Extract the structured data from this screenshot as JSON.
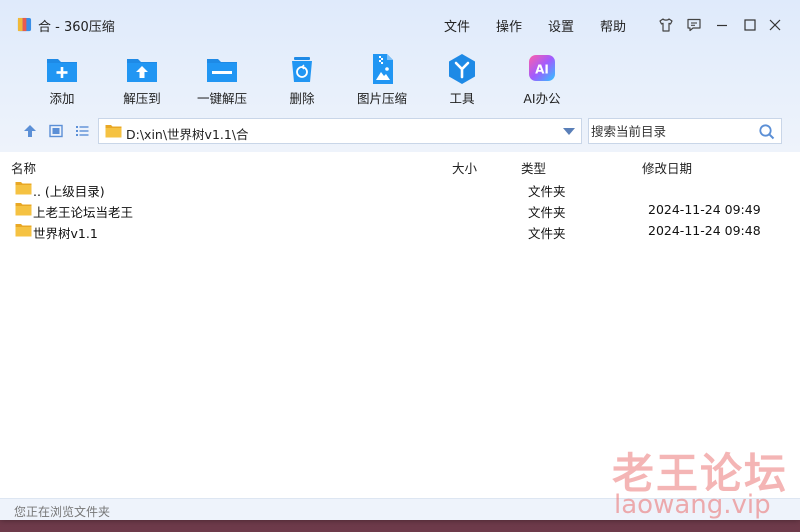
{
  "window": {
    "title": "合 - 360压缩"
  },
  "menu": [
    "文件",
    "操作",
    "设置",
    "帮助"
  ],
  "toolbar": [
    {
      "label": "添加",
      "icon": "add-icon"
    },
    {
      "label": "解压到",
      "icon": "extract-to-icon"
    },
    {
      "label": "一键解压",
      "icon": "one-click-extract-icon"
    },
    {
      "label": "删除",
      "icon": "delete-icon"
    },
    {
      "label": "图片压缩",
      "icon": "image-compress-icon"
    },
    {
      "label": "工具",
      "icon": "tools-icon"
    },
    {
      "label": "AI办公",
      "icon": "ai-office-icon"
    }
  ],
  "address": {
    "path": "D:\\xin\\世界树v1.1\\合"
  },
  "search": {
    "placeholder": "搜索当前目录"
  },
  "columns": {
    "name": "名称",
    "size": "大小",
    "type": "类型",
    "modified": "修改日期"
  },
  "rows": [
    {
      "name": ".. (上级目录)",
      "size": "",
      "type": "文件夹",
      "date": ""
    },
    {
      "name": "上老王论坛当老王",
      "size": "",
      "type": "文件夹",
      "date": "2024-11-24 09:49"
    },
    {
      "name": "世界树v1.1",
      "size": "",
      "type": "文件夹",
      "date": "2024-11-24 09:48"
    }
  ],
  "status": "您正在浏览文件夹",
  "watermark": {
    "line1": "老王论坛",
    "line2": "laowang.vip"
  },
  "colors": {
    "accent": "#1e8ae6",
    "folder": "#f5c242"
  }
}
